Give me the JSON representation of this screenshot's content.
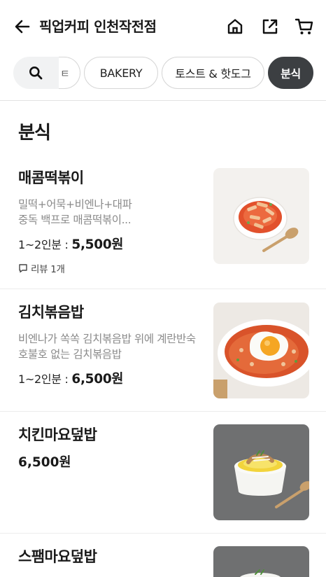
{
  "header": {
    "title": "픽업커피 인천작전점",
    "back_icon": "arrow-left-icon",
    "home_icon": "home-icon",
    "share_icon": "share-icon",
    "cart_icon": "cart-icon"
  },
  "categories": {
    "peek_label": "ㅌ",
    "items": [
      "BAKERY",
      "토스트 & 핫도그",
      "분식"
    ],
    "active": "분식"
  },
  "section_title": "분식",
  "menu": [
    {
      "name": "매콤떡볶이",
      "description": "밀떡+어묵+비엔나+대파 중독 백프로 매콤떡볶이...",
      "serving": "1~2인분 : ",
      "price": "5,500원",
      "review": "리뷰 1개"
    },
    {
      "name": "김치볶음밥",
      "description": "비엔나가 쏙쏙 김치볶음밥 위에 계란반숙 호불호 없는 김치볶음밥",
      "serving": "1~2인분 : ",
      "price": "6,500원"
    },
    {
      "name": "치킨마요덮밥",
      "price": "6,500원"
    },
    {
      "name": "스팸마요덮밥"
    }
  ],
  "colors": {
    "active_chip": "#3c3f42",
    "muted_text": "#8a8a8a",
    "search_chip_bg": "#f1f2f3"
  }
}
